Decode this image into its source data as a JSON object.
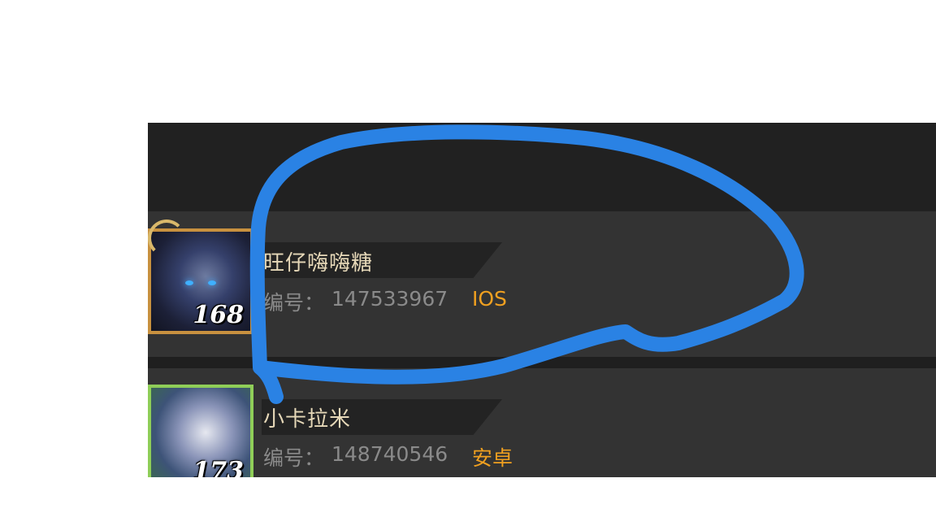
{
  "players": [
    {
      "name": "旺仔嗨嗨糖",
      "id_label": "编号：",
      "id_value": "147533967",
      "platform": "IOS",
      "level": "168",
      "frame_color": "#c8913f"
    },
    {
      "name": "小卡拉米",
      "id_label": "编号：",
      "id_value": "148740546",
      "platform": "安卓",
      "level": "173",
      "frame_color": "#8fce58"
    }
  ],
  "colors": {
    "background": "#ffffff",
    "panel": "#222222",
    "row": "#333333",
    "name_text": "#e6d8b8",
    "id_text": "#8a8a8a",
    "platform_text": "#f0a020",
    "annotation_stroke": "#2a82e4"
  },
  "annotation": {
    "type": "freehand-circle"
  }
}
